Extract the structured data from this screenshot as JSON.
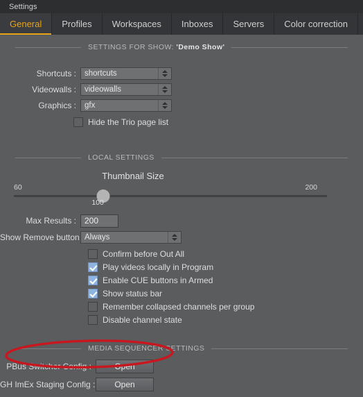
{
  "window": {
    "title": "Settings"
  },
  "tabs": [
    {
      "label": "General",
      "active": true
    },
    {
      "label": "Profiles",
      "active": false
    },
    {
      "label": "Workspaces",
      "active": false
    },
    {
      "label": "Inboxes",
      "active": false
    },
    {
      "label": "Servers",
      "active": false
    },
    {
      "label": "Color correction",
      "active": false
    }
  ],
  "show_section": {
    "header_prefix": "SETTINGS FOR SHOW: ",
    "header_show_name": "'Demo Show'",
    "fields": [
      {
        "label": "Shortcuts :",
        "value": "shortcuts"
      },
      {
        "label": "Videowalls :",
        "value": "videowalls"
      },
      {
        "label": "Graphics :",
        "value": "gfx"
      }
    ],
    "hide_trio": {
      "label": "Hide the Trio page list",
      "checked": false
    }
  },
  "local_section": {
    "header": "LOCAL SETTINGS",
    "slider": {
      "title": "Thumbnail Size",
      "min": "60",
      "max": "200",
      "value": "100",
      "percent": 28.5
    },
    "max_results": {
      "label": "Max Results :",
      "value": "200"
    },
    "remove_button": {
      "label": "Show Remove button :",
      "value": "Always"
    },
    "checkboxes": [
      {
        "label": "Confirm before Out All",
        "checked": false
      },
      {
        "label": "Play videos locally in Program",
        "checked": true
      },
      {
        "label": "Enable CUE buttons in Armed",
        "checked": true
      },
      {
        "label": "Show status bar",
        "checked": true
      },
      {
        "label": "Remember collapsed channels per group",
        "checked": false
      },
      {
        "label": "Disable channel state",
        "checked": false
      }
    ]
  },
  "media_section": {
    "header": "MEDIA SEQUENCER SETTINGS",
    "rows": [
      {
        "label": "PBus Switcher Config :",
        "button": "Open",
        "highlighted": true
      },
      {
        "label": "GH ImEx Staging Config :",
        "button": "Open",
        "highlighted": false
      }
    ]
  },
  "colors": {
    "accent": "#e8a317",
    "checkbox": "#8fb4e0",
    "annotation": "#c8171e",
    "background": "#5a5c5e"
  }
}
